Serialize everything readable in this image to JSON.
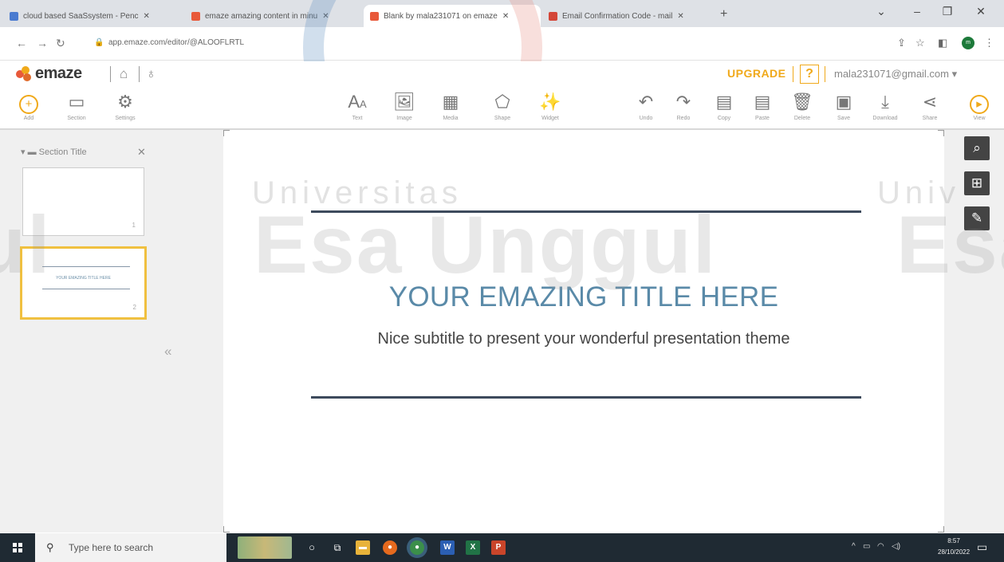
{
  "browser": {
    "tabs": [
      {
        "label": "cloud based SaaSsystem - Penc",
        "favicon_color": "#4a7bd0",
        "active": false
      },
      {
        "label": "emaze amazing content in minu",
        "favicon_color": "#e8593a",
        "active": false
      },
      {
        "label": "Blank by mala231071 on emaze",
        "favicon_color": "#e8593a",
        "active": true
      },
      {
        "label": "Email Confirmation Code - mail",
        "favicon_color": "#d44638",
        "active": false
      }
    ],
    "new_tab": "+",
    "url": "app.emaze.com/editor/@ALOOFLRTL",
    "profile_initials": "m"
  },
  "app": {
    "logo_text": "emaze",
    "upgrade_label": "UPGRADE",
    "help_label": "?",
    "user_email": "mala231071@gmail.com ▾"
  },
  "toolbar": {
    "left": [
      {
        "label": "Add",
        "icon": "add-icon"
      },
      {
        "label": "Section",
        "icon": "section-icon"
      },
      {
        "label": "Settings",
        "icon": "settings-icon"
      }
    ],
    "insert": [
      {
        "label": "Text",
        "icon": "text-icon"
      },
      {
        "label": "Image",
        "icon": "image-icon"
      },
      {
        "label": "Media",
        "icon": "media-icon"
      },
      {
        "label": "Shape",
        "icon": "shape-icon"
      },
      {
        "label": "Widget",
        "icon": "widget-icon"
      }
    ],
    "edit": [
      {
        "label": "Undo",
        "icon": "undo-icon"
      },
      {
        "label": "Redo",
        "icon": "redo-icon"
      },
      {
        "label": "Copy",
        "icon": "copy-icon"
      },
      {
        "label": "Paste",
        "icon": "paste-icon"
      },
      {
        "label": "Delete",
        "icon": "delete-icon"
      },
      {
        "label": "Save",
        "icon": "save-icon"
      },
      {
        "label": "Download",
        "icon": "download-icon"
      },
      {
        "label": "Share",
        "icon": "share-icon"
      },
      {
        "label": "View",
        "icon": "view-icon"
      }
    ]
  },
  "sidebar": {
    "section_title": "Section Title",
    "slides": [
      {
        "number": "1"
      },
      {
        "number": "2",
        "selected": true
      }
    ]
  },
  "slide": {
    "title": "YOUR EMAZING TITLE HERE",
    "subtitle": "Nice subtitle to present your wonderful presentation theme"
  },
  "watermark": {
    "line1": "Universitas",
    "line2": "Esa Unggul",
    "right1": "Univ",
    "right2": "Esa",
    "left2": "ul"
  },
  "taskbar": {
    "search_placeholder": "Type here to search",
    "time": "8:57",
    "date": "28/10/2022"
  },
  "colors": {
    "accent": "#f0a91a",
    "slide_title": "#5a8aa8",
    "rule": "#3d4a5c"
  }
}
